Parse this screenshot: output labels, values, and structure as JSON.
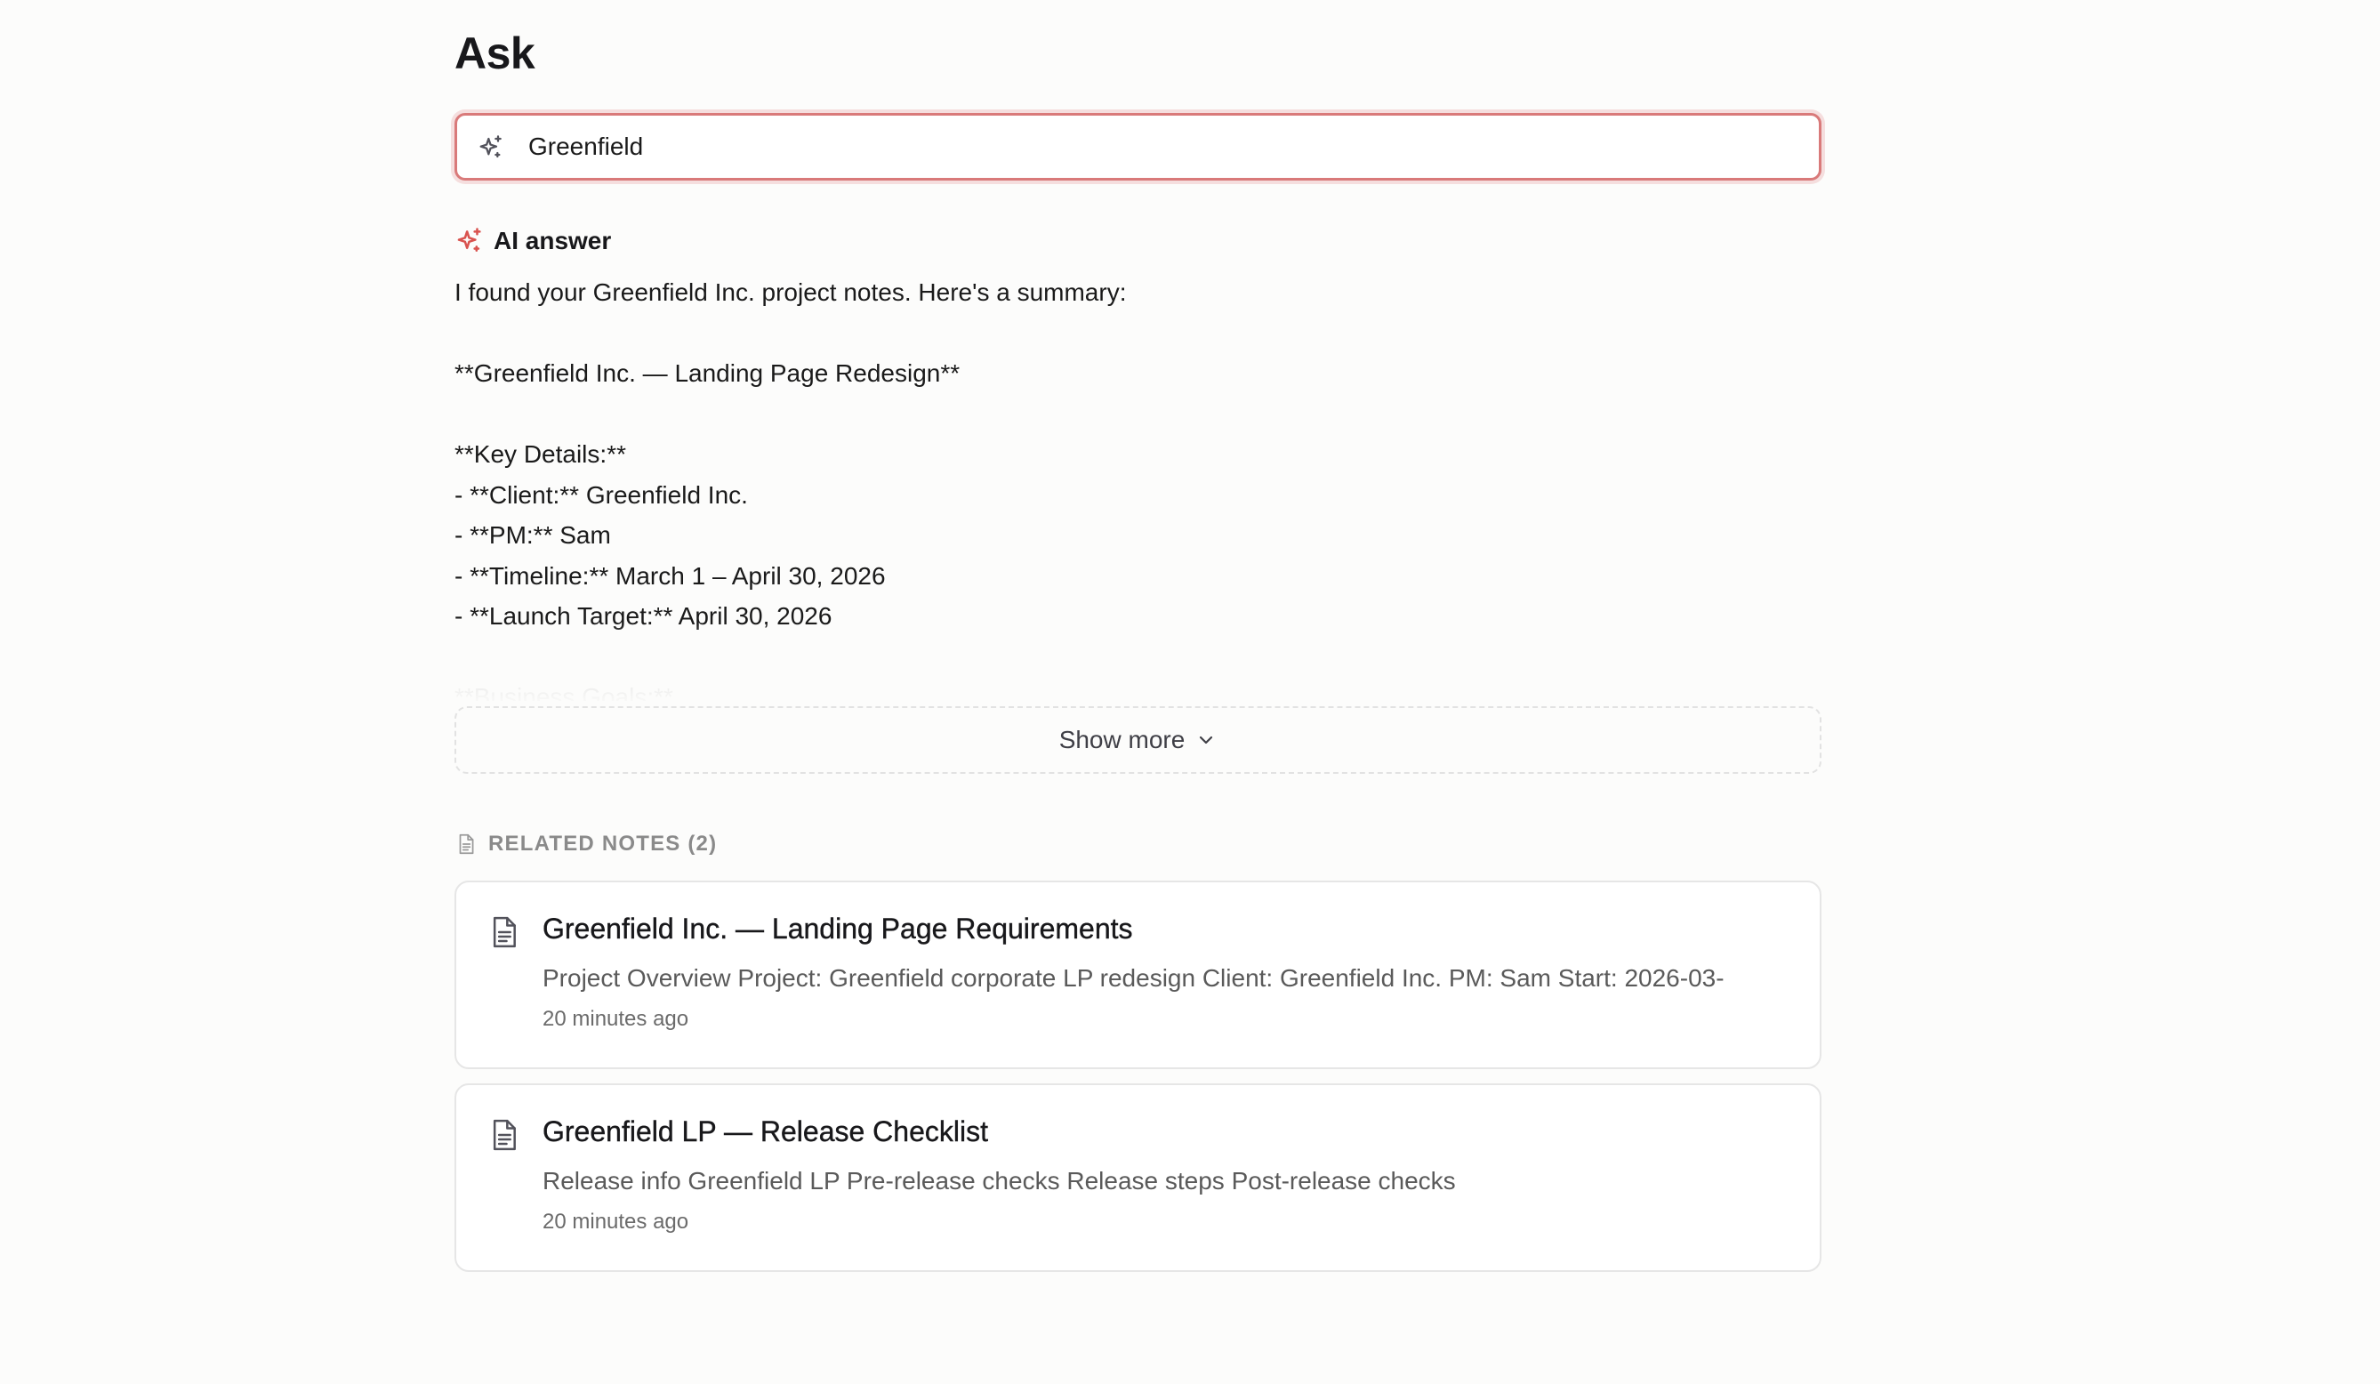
{
  "page": {
    "title": "Ask"
  },
  "search": {
    "value": "Greenfield",
    "icon": "sparkles-icon",
    "focus_color": "#d97a7a"
  },
  "ai_answer": {
    "title": "AI answer",
    "icon": "sparkles-icon",
    "icon_color": "#d9534f",
    "lines": [
      "I found your Greenfield Inc. project notes. Here's a summary:",
      "",
      "**Greenfield Inc. — Landing Page Redesign**",
      "",
      "**Key Details:**",
      "- **Client:** Greenfield Inc.",
      "- **PM:** Sam",
      "- **Timeline:** March 1 – April 30, 2026",
      "- **Launch Target:** April 30, 2026",
      "",
      "**Business Goals:**"
    ],
    "show_more_label": "Show more"
  },
  "related_notes": {
    "label": "RELATED NOTES (2)",
    "icon": "document-icon",
    "items": [
      {
        "title": "Greenfield Inc. — Landing Page Requirements",
        "snippet": "Project Overview Project: Greenfield corporate LP redesign Client: Greenfield Inc. PM: Sam Start: 2026-03-",
        "time": "20 minutes ago"
      },
      {
        "title": "Greenfield LP — Release Checklist",
        "snippet": "Release info Greenfield LP Pre-release checks Release steps Post-release checks",
        "time": "20 minutes ago"
      }
    ]
  }
}
